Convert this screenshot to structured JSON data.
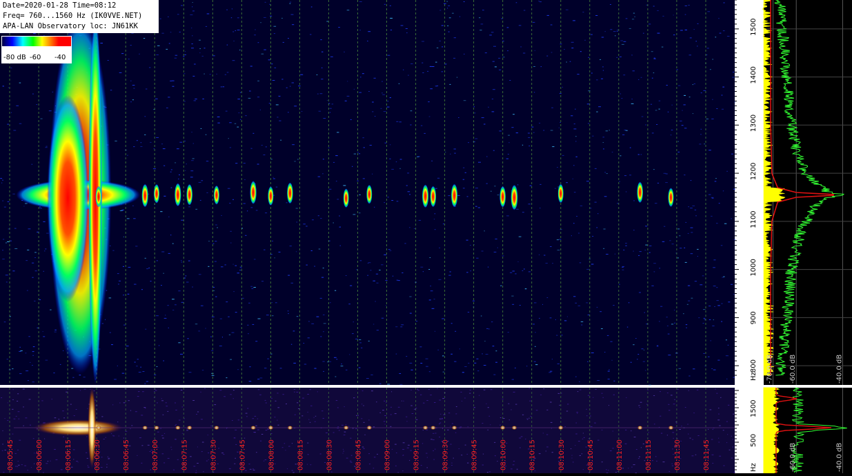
{
  "header": {
    "line1": "Date=2020-01-28 Time=08:12",
    "line2": "Freq= 760...1560 Hz (IK0VVE.NET)",
    "line3": "APA-LAN Observatory loc: JN61KK"
  },
  "colorbar": {
    "labels": [
      "-80 dB",
      "-60",
      "-40"
    ]
  },
  "colors": {
    "background": "#00002a",
    "grid": "#4a8a3a",
    "spectrum_green": "#33ff33",
    "spectrum_yellow": "#ffff00",
    "spectrum_red": "#dd1111",
    "time_label": "#ff2020"
  },
  "chart_data": [
    {
      "type": "heatmap",
      "title": "",
      "yaxis": {
        "unit": "Hz",
        "ticks": [
          800,
          900,
          1000,
          1100,
          1200,
          1300,
          1400,
          1500
        ],
        "range": [
          760,
          1560
        ]
      },
      "xaxis": {
        "ticks": [
          "08:05:45",
          "08:06:00",
          "08:06:15",
          "08:06:30",
          "08:06:45",
          "08:07:00",
          "08:07:15",
          "08:07:30",
          "08:07:45",
          "08:08:00",
          "08:08:15",
          "08:08:30",
          "08:08:45",
          "08:09:00",
          "08:09:15",
          "08:09:30",
          "08:09:45",
          "08:10:00",
          "08:10:15",
          "08:10:30",
          "08:10:45",
          "08:11:00",
          "08:11:15",
          "08:11:30",
          "08:11:45"
        ],
        "range": [
          "08:05:40",
          "08:12:00"
        ]
      },
      "carrier_hz": 1155,
      "events": [
        {
          "time_s": 19,
          "strength": 1.0
        },
        {
          "time_s": 51,
          "strength": 0.25
        },
        {
          "time_s": 75,
          "strength": 0.3
        },
        {
          "time_s": 81,
          "strength": 0.2
        },
        {
          "time_s": 92,
          "strength": 0.3
        },
        {
          "time_s": 98,
          "strength": 0.25
        },
        {
          "time_s": 112,
          "strength": 0.2
        },
        {
          "time_s": 131,
          "strength": 0.3
        },
        {
          "time_s": 140,
          "strength": 0.2
        },
        {
          "time_s": 150,
          "strength": 0.25
        },
        {
          "time_s": 179,
          "strength": 0.2
        },
        {
          "time_s": 191,
          "strength": 0.2
        },
        {
          "time_s": 220,
          "strength": 0.3
        },
        {
          "time_s": 224,
          "strength": 0.25
        },
        {
          "time_s": 235,
          "strength": 0.3
        },
        {
          "time_s": 260,
          "strength": 0.25
        },
        {
          "time_s": 266,
          "strength": 0.35
        },
        {
          "time_s": 290,
          "strength": 0.2
        },
        {
          "time_s": 331,
          "strength": 0.25
        },
        {
          "time_s": 347,
          "strength": 0.2
        }
      ]
    },
    {
      "type": "line",
      "title": "",
      "xaxis": {
        "ticks": [
          "-70.0 dB",
          "-60.0 dB",
          "-40.0 dB"
        ]
      },
      "yaxis": {
        "unit": "Hz",
        "range": [
          760,
          1560
        ]
      },
      "series": [
        {
          "color": "#33ff33",
          "y_hz": [
            780,
            850,
            900,
            950,
            1000,
            1050,
            1100,
            1130,
            1150,
            1155,
            1160,
            1180,
            1200,
            1250,
            1300,
            1350,
            1400,
            1450,
            1500,
            1560
          ],
          "x_db": [
            -67,
            -65,
            -64,
            -63,
            -62,
            -60,
            -56,
            -52,
            -46,
            -40,
            -46,
            -52,
            -56,
            -60,
            -62,
            -63,
            -64,
            -65,
            -66,
            -67
          ]
        },
        {
          "color": "#dd1111",
          "y_hz": [
            780,
            900,
            1000,
            1100,
            1140,
            1150,
            1155,
            1160,
            1170,
            1200,
            1300,
            1400,
            1500,
            1560
          ],
          "x_db": [
            -71,
            -71,
            -71,
            -70.5,
            -68,
            -60,
            -40,
            -60,
            -68,
            -70.5,
            -71,
            -71,
            -71,
            -71
          ]
        },
        {
          "color": "#ffff00",
          "y_hz": [
            780,
            900,
            1000,
            1100,
            1200,
            1300,
            1400,
            1500,
            1560
          ],
          "x_db": [
            -71.5,
            -71.5,
            -71.8,
            -72,
            -72,
            -72.2,
            -72.3,
            -72.4,
            -72.5
          ]
        }
      ]
    },
    {
      "type": "heatmap",
      "title": "",
      "yaxis": {
        "unit": "Hz",
        "ticks": [
          500,
          1500
        ]
      }
    },
    {
      "type": "line",
      "title": "",
      "xaxis": {
        "ticks": [
          "-60.0 dB",
          "-40.0 dB"
        ]
      }
    }
  ]
}
